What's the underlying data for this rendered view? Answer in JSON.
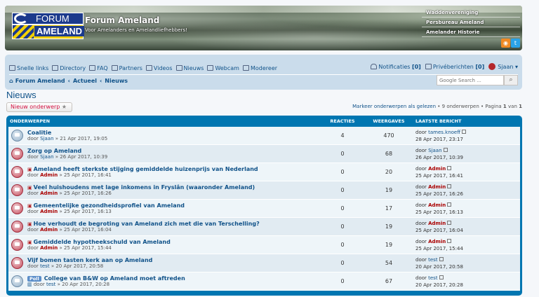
{
  "header": {
    "logo_top": "FORUM",
    "logo_bottom": "AMELAND",
    "site_title": "Forum Ameland",
    "site_desc": "Voor Amelanders en Amelandliefhebbers!",
    "links": [
      "Waddenvereniging",
      "Persbureau Ameland",
      "Amelander Historie"
    ]
  },
  "navbar": {
    "left": [
      {
        "label": "Snelle links",
        "icon": "menu-icon"
      },
      {
        "label": "Directory",
        "icon": "directory-icon"
      },
      {
        "label": "FAQ",
        "icon": "faq-icon"
      },
      {
        "label": "Partners",
        "icon": "partners-icon"
      },
      {
        "label": "Videos",
        "icon": "videos-icon"
      },
      {
        "label": "Nieuws",
        "icon": "news-icon"
      },
      {
        "label": "Webcam",
        "icon": "webcam-icon"
      },
      {
        "label": "Modereer",
        "icon": "moderate-icon"
      }
    ],
    "notifications": "Notificaties",
    "notifications_count": "[0]",
    "pm": "Privéberichten",
    "pm_count": "[0]",
    "user": "Sjaan",
    "breadcrumb": [
      "Forum Ameland",
      "Actueel",
      "Nieuws"
    ],
    "search_placeholder": "Google Search ..."
  },
  "page": {
    "title": "Nieuws",
    "new_topic": "Nieuw onderwerp",
    "mark_read": "Markeer onderwerpen als gelezen",
    "topic_count": "9 onderwerpen",
    "page_label": "Pagina",
    "page_current": "1",
    "page_of": "van",
    "page_total": "1"
  },
  "table": {
    "headers": [
      "ONDERWERPEN",
      "REACTIES",
      "WEERGAVES",
      "LAATSTE BERICHT"
    ],
    "rows": [
      {
        "title": "Coalitie",
        "by": "door",
        "author": "Sjaan",
        "date": "» 21 Apr 2017, 19:05",
        "replies": "4",
        "views": "470",
        "last_by": "tames.knoeff",
        "last_date": "28 Apr 2017, 23:17",
        "icon": "blue",
        "admin": false,
        "pdf": false,
        "poll": false
      },
      {
        "title": "Zorg op Ameland",
        "by": "door",
        "author": "Sjaan",
        "date": "» 26 Apr 2017, 10:39",
        "replies": "0",
        "views": "68",
        "last_by": "Sjaan",
        "last_date": "26 Apr 2017, 10:39",
        "icon": "red",
        "admin": false,
        "pdf": false,
        "poll": false
      },
      {
        "title": "Ameland heeft sterkste stijging gemiddelde huizenprijs van Nederland",
        "by": "door",
        "author": "Admin",
        "date": "» 25 Apr 2017, 16:41",
        "replies": "0",
        "views": "20",
        "last_by": "Admin",
        "last_date": "25 Apr 2017, 16:41",
        "icon": "red",
        "admin": true,
        "pdf": true,
        "poll": false
      },
      {
        "title": "Veel huishoudens met lage inkomens in Fryslân (waaronder Ameland)",
        "by": "door",
        "author": "Admin",
        "date": "» 25 Apr 2017, 16:26",
        "replies": "0",
        "views": "19",
        "last_by": "Admin",
        "last_date": "25 Apr 2017, 16:26",
        "icon": "red",
        "admin": true,
        "pdf": true,
        "poll": false
      },
      {
        "title": "Gemeentelijke gezondheidsprofiel van Ameland",
        "by": "door",
        "author": "Admin",
        "date": "» 25 Apr 2017, 16:13",
        "replies": "0",
        "views": "17",
        "last_by": "Admin",
        "last_date": "25 Apr 2017, 16:13",
        "icon": "red",
        "admin": true,
        "pdf": true,
        "poll": false
      },
      {
        "title": "Hoe verhoudt de begroting van Ameland zich met die van Terschelling?",
        "by": "door",
        "author": "Admin",
        "date": "» 25 Apr 2017, 16:04",
        "replies": "0",
        "views": "19",
        "last_by": "Admin",
        "last_date": "25 Apr 2017, 16:04",
        "icon": "red",
        "admin": true,
        "pdf": true,
        "poll": false
      },
      {
        "title": "Gemiddelde hypotheekschuld van Ameland",
        "by": "door",
        "author": "Admin",
        "date": "» 25 Apr 2017, 15:44",
        "replies": "0",
        "views": "19",
        "last_by": "Admin",
        "last_date": "25 Apr 2017, 15:44",
        "icon": "red",
        "admin": true,
        "pdf": true,
        "poll": false
      },
      {
        "title": "Vijf bomen tasten kerk aan op Ameland",
        "by": "door",
        "author": "test",
        "date": "» 20 Apr 2017, 20:58",
        "replies": "0",
        "views": "54",
        "last_by": "test",
        "last_date": "20 Apr 2017, 20:58",
        "icon": "red",
        "admin": false,
        "pdf": false,
        "poll": false
      },
      {
        "title": "College van B&W op Ameland moet aftreden",
        "by": "door",
        "author": "test",
        "date": "» 20 Apr 2017, 20:28",
        "replies": "0",
        "views": "67",
        "last_by": "test",
        "last_date": "20 Apr 2017, 20:28",
        "icon": "blue",
        "admin": false,
        "pdf": false,
        "poll": true,
        "poll_label": "Poll"
      }
    ]
  }
}
